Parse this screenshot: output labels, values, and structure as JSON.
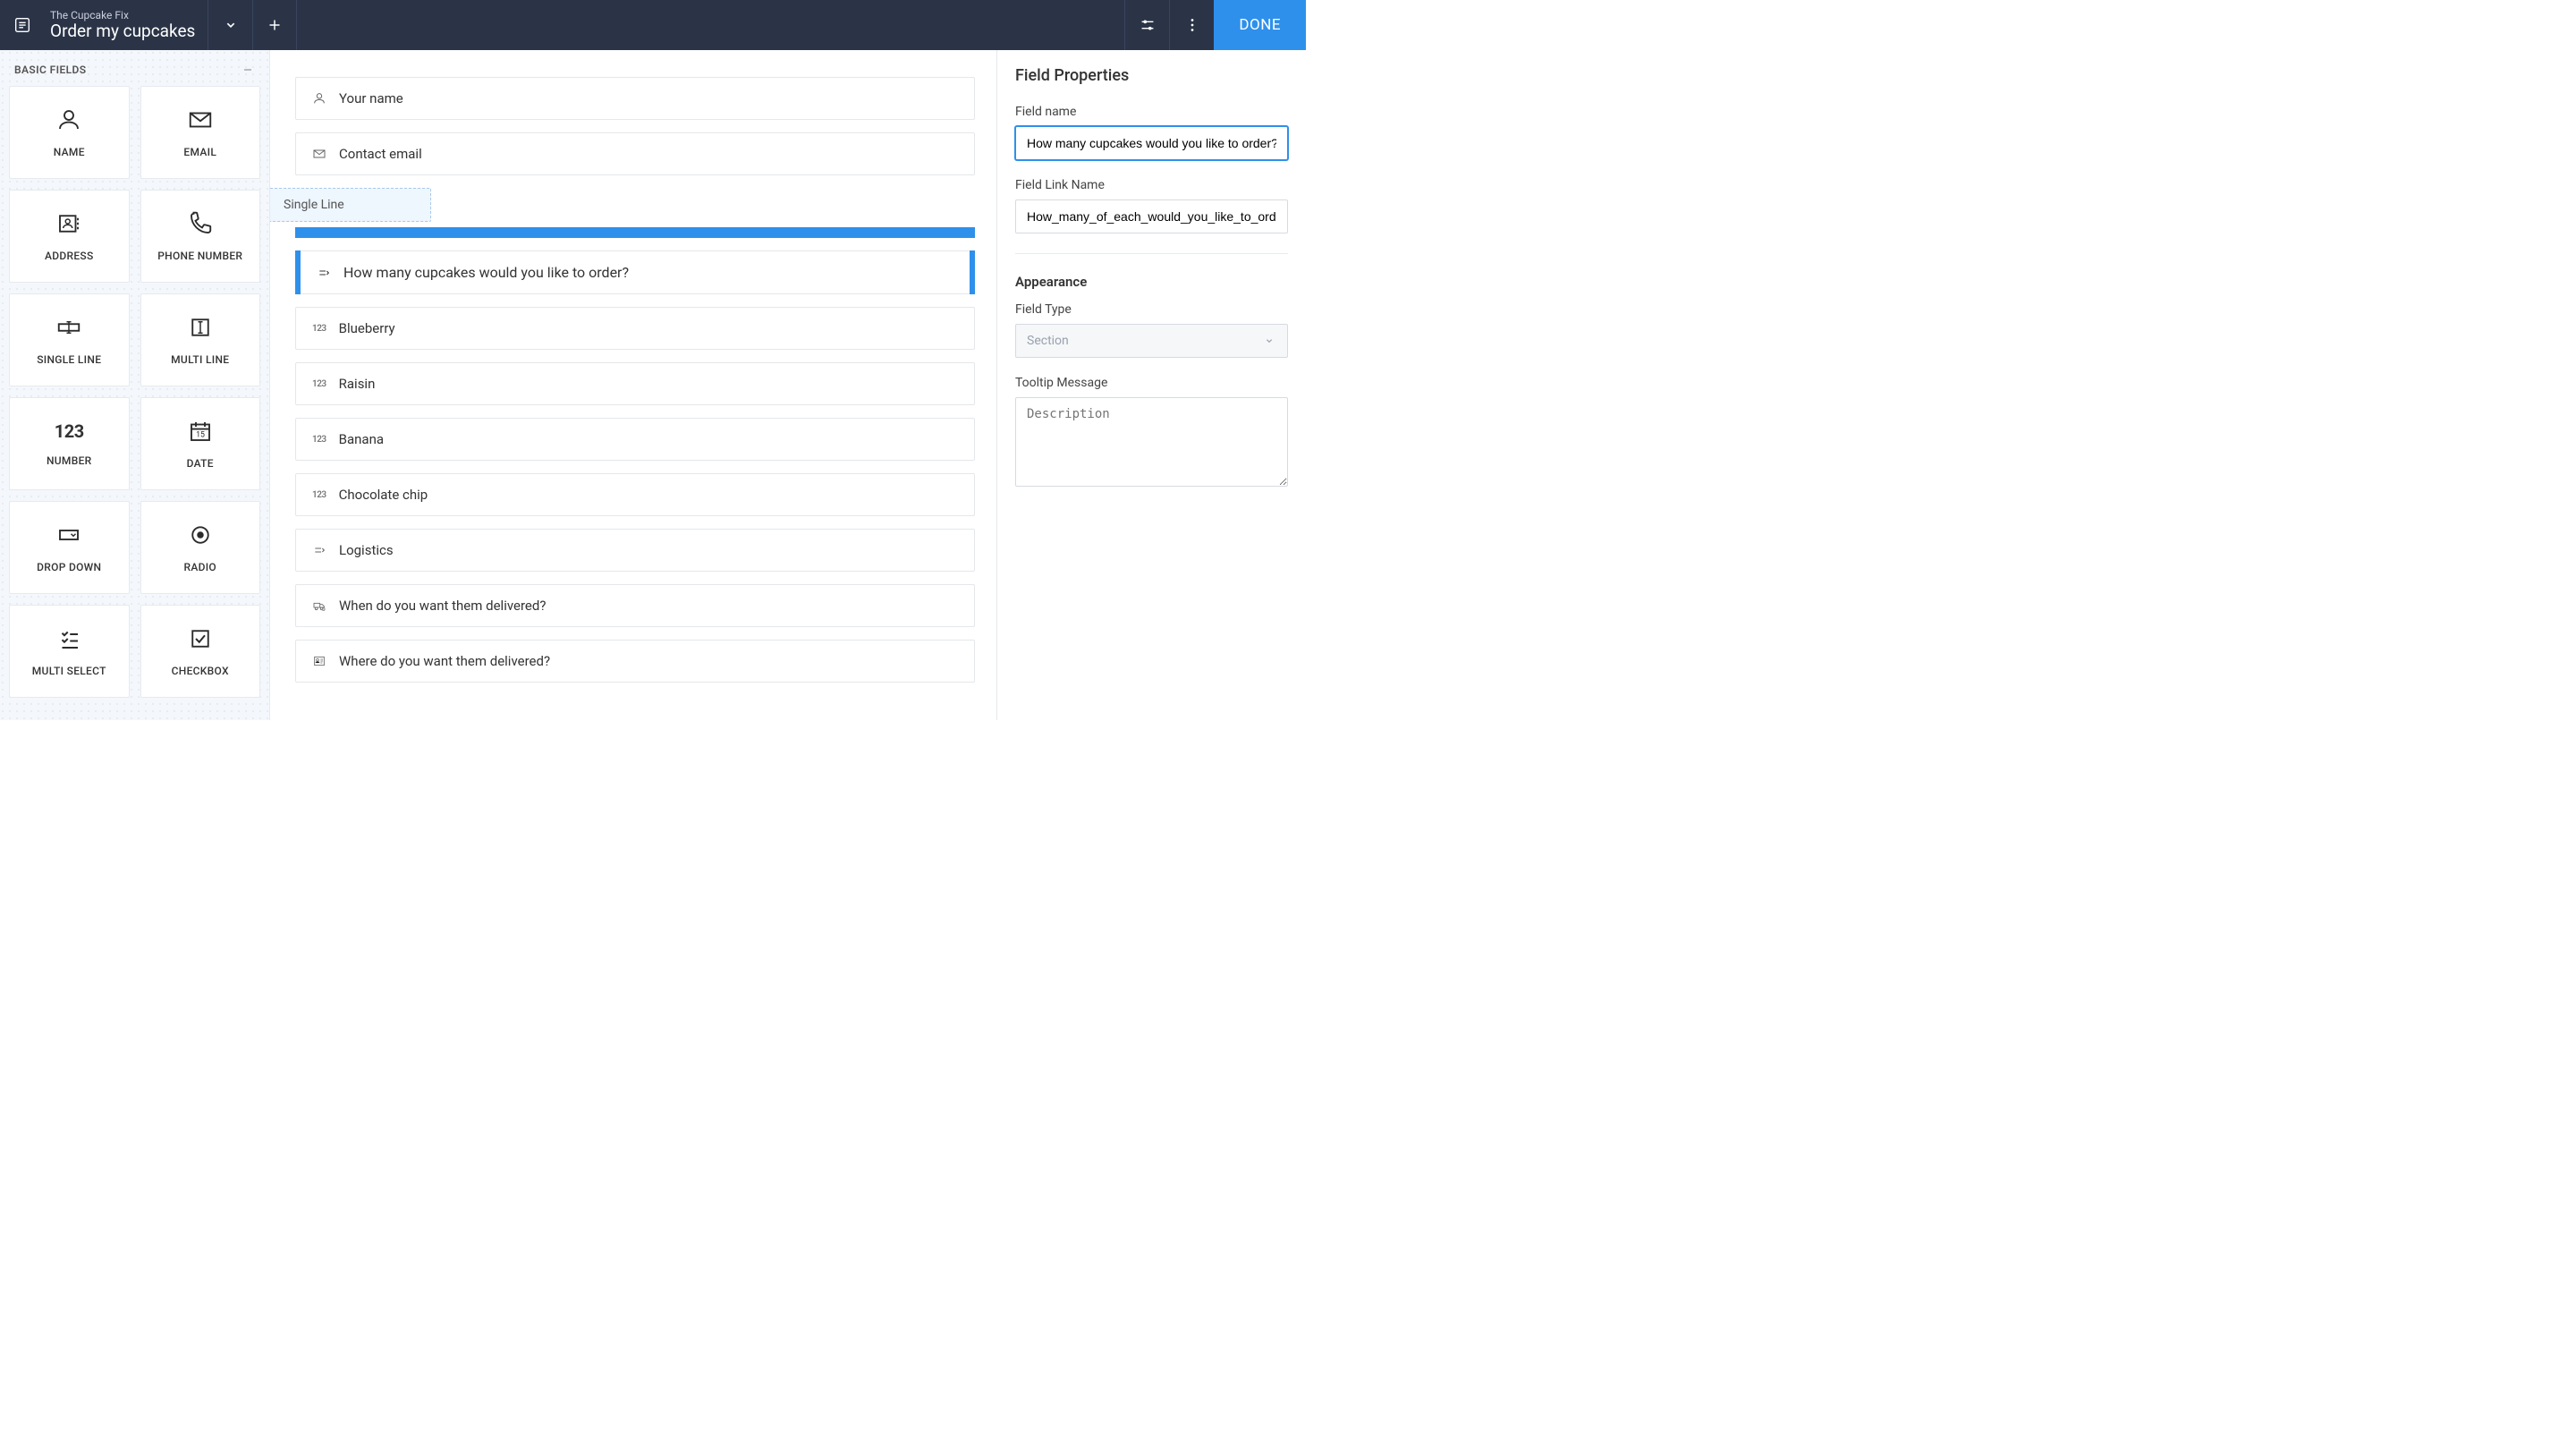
{
  "header": {
    "subtitle": "The Cupcake Fix",
    "title": "Order my cupcakes",
    "done_label": "DONE"
  },
  "sidebar": {
    "section_title": "BASIC FIELDS",
    "items": [
      {
        "label": "NAME",
        "icon": "user"
      },
      {
        "label": "EMAIL",
        "icon": "mail"
      },
      {
        "label": "ADDRESS",
        "icon": "contact-card"
      },
      {
        "label": "PHONE NUMBER",
        "icon": "phone"
      },
      {
        "label": "SINGLE LINE",
        "icon": "single-line"
      },
      {
        "label": "MULTI LINE",
        "icon": "multi-line"
      },
      {
        "label": "NUMBER",
        "icon": "number-123"
      },
      {
        "label": "DATE",
        "icon": "calendar"
      },
      {
        "label": "DROP DOWN",
        "icon": "dropdown"
      },
      {
        "label": "RADIO",
        "icon": "radio"
      },
      {
        "label": "MULTI SELECT",
        "icon": "multiselect"
      },
      {
        "label": "CHECKBOX",
        "icon": "checkbox"
      }
    ]
  },
  "canvas": {
    "drop_ghost_label": "Single Line",
    "fields": [
      {
        "label": "Your name",
        "icon": "user",
        "selected": false
      },
      {
        "label": "Contact email",
        "icon": "mail",
        "selected": false
      },
      {
        "label": "How many cupcakes would you like to order?",
        "icon": "section",
        "selected": true,
        "drop_before": true
      },
      {
        "label": "Blueberry",
        "icon": "num",
        "selected": false
      },
      {
        "label": "Raisin",
        "icon": "num",
        "selected": false
      },
      {
        "label": "Banana",
        "icon": "num",
        "selected": false
      },
      {
        "label": "Chocolate chip",
        "icon": "num",
        "selected": false
      },
      {
        "label": "Logistics",
        "icon": "section",
        "selected": false
      },
      {
        "label": "When do you want them delivered?",
        "icon": "truck-clock",
        "selected": false
      },
      {
        "label": "Where do you want them delivered?",
        "icon": "address-card",
        "selected": false
      }
    ]
  },
  "properties": {
    "panel_title": "Field Properties",
    "field_name_label": "Field name",
    "field_name_value": "How many cupcakes would you like to order?",
    "field_link_label": "Field Link Name",
    "field_link_value": "How_many_of_each_would_you_like_to_ord",
    "appearance_title": "Appearance",
    "field_type_label": "Field Type",
    "field_type_value": "Section",
    "tooltip_label": "Tooltip Message",
    "tooltip_placeholder": "Description"
  },
  "icons": {
    "number_badge": "123"
  }
}
